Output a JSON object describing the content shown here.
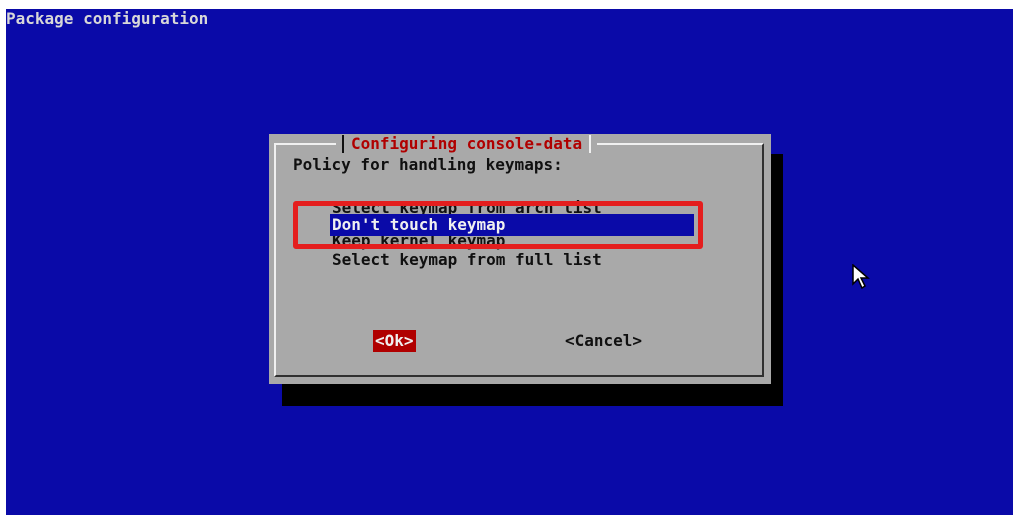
{
  "screen": {
    "title": "Package configuration"
  },
  "dialog": {
    "title": "Configuring console-data",
    "prompt": "Policy for handling keymaps:",
    "options": [
      "Select keymap from arch list",
      "Don't touch keymap",
      "Keep kernel keymap",
      "Select keymap from full list"
    ],
    "selected_index": 1,
    "ok_label": "<Ok>",
    "cancel_label": "<Cancel>"
  },
  "colors": {
    "background": "#0a0aa8",
    "dialog": "#a9a9a9",
    "title_text": "#b00000",
    "selection": "#0a0aa8",
    "annotation_box": "#e41e1e"
  },
  "icons": {
    "pointer": "mouse-pointer-icon"
  }
}
